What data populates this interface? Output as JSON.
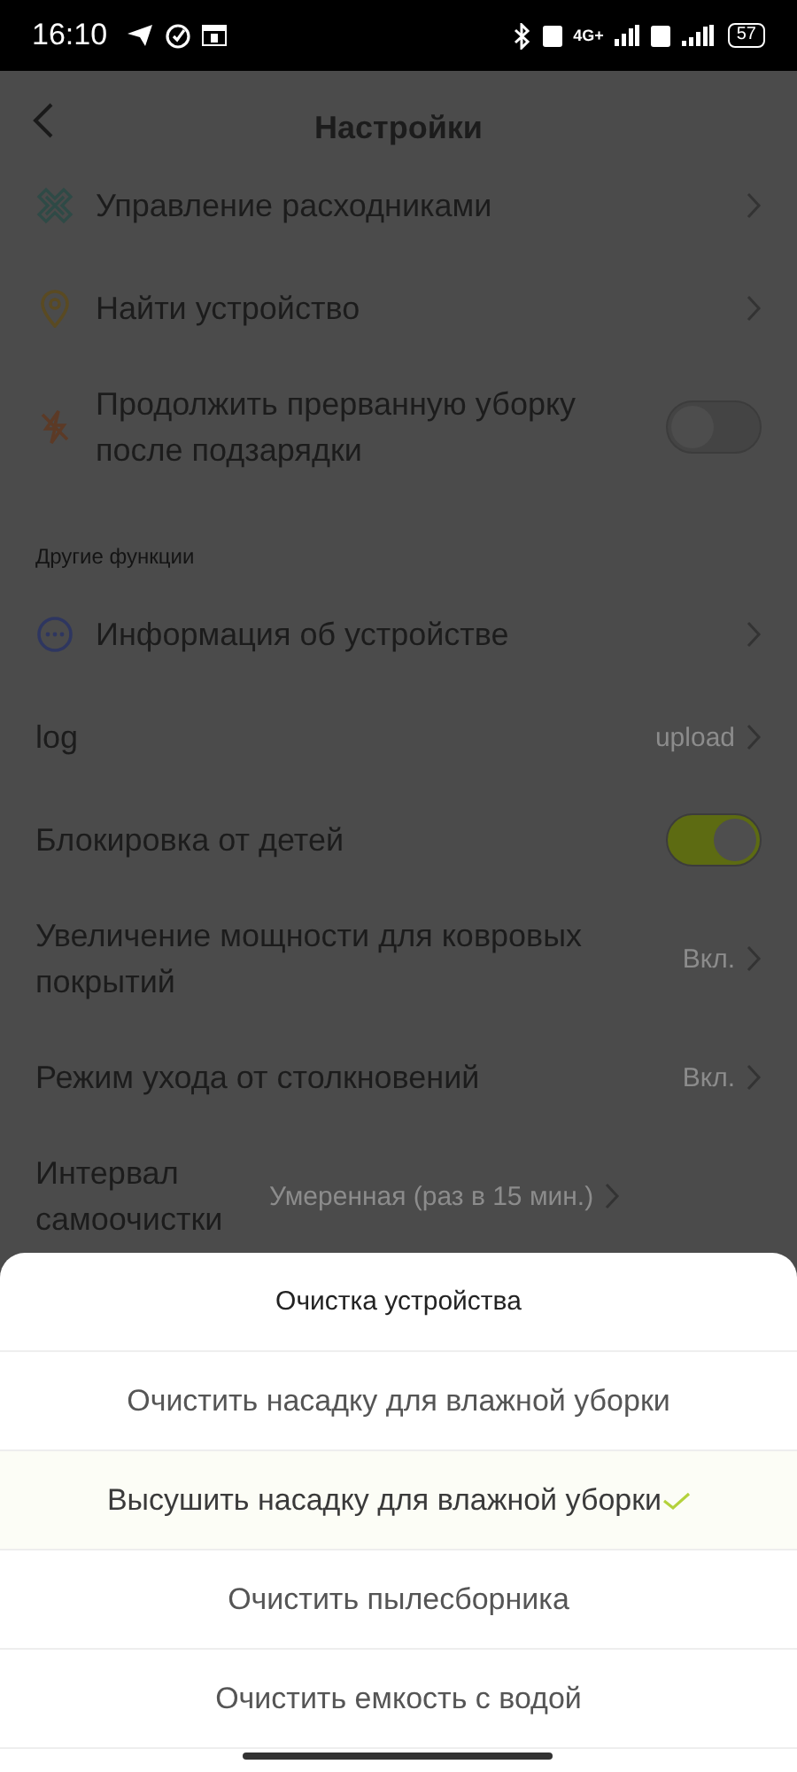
{
  "status_bar": {
    "time": "16:10",
    "network": "4G+",
    "battery": "57"
  },
  "header": {
    "title": "Настройки"
  },
  "sections": [
    {
      "rows": [
        {
          "kind": "link",
          "label": "Управление расходниками"
        },
        {
          "kind": "link",
          "label": "Найти устройство"
        },
        {
          "kind": "toggle",
          "label": "Продолжить прерванную уборку после подзарядки",
          "on": false
        }
      ]
    },
    {
      "label": "Другие функции",
      "rows": [
        {
          "kind": "link",
          "label": "Информация об устройстве"
        },
        {
          "kind": "link",
          "label": "log",
          "value": "upload"
        },
        {
          "kind": "toggle",
          "label": "Блокировка от детей",
          "on": true
        },
        {
          "kind": "link",
          "label": "Увеличение мощности для ковровых покрытий",
          "value": "Вкл."
        },
        {
          "kind": "link",
          "label": "Режим ухода от столкновений",
          "value": "Вкл."
        },
        {
          "kind": "link",
          "label": "Интервал самоочистки",
          "value": "Умеренная (раз в 15 мин.)"
        }
      ]
    }
  ],
  "sheet": {
    "title": "Очистка устройства",
    "options": [
      {
        "label": "Очистить насадку для влажной уборки",
        "selected": false
      },
      {
        "label": "Высушить насадку для влажной уборки",
        "selected": true
      },
      {
        "label": "Очистить пылесборника",
        "selected": false
      },
      {
        "label": "Очистить емкость с водой",
        "selected": false
      }
    ]
  }
}
